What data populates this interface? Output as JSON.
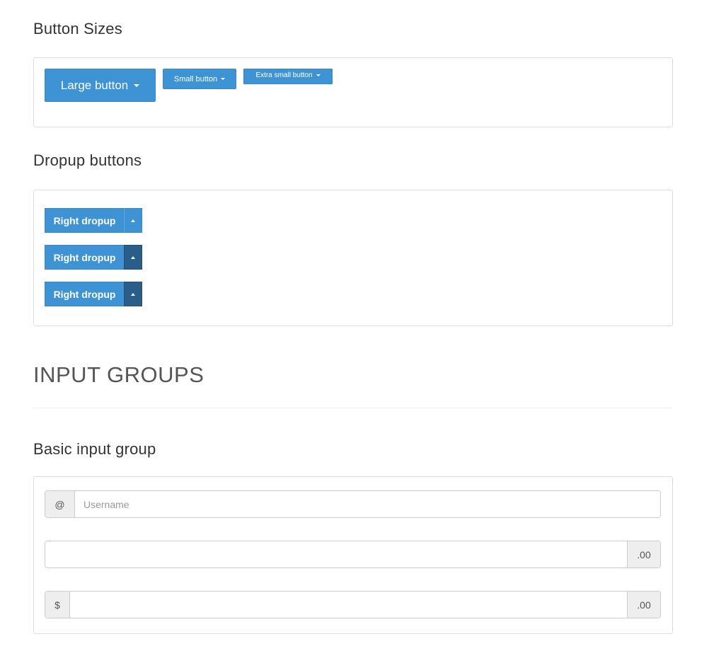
{
  "sections": {
    "button_sizes_title": "Button Sizes",
    "dropup_title": "Dropup buttons",
    "input_groups_title": "INPUT GROUPS",
    "basic_input_group_title": "Basic input group"
  },
  "button_sizes": {
    "large": "Large button",
    "small": "Small button",
    "extra_small": "Extra small button"
  },
  "dropups": [
    {
      "label": "Right dropup",
      "toggle_state": "normal"
    },
    {
      "label": "Right dropup",
      "toggle_state": "active"
    },
    {
      "label": "Right dropup",
      "toggle_state": "active"
    }
  ],
  "input_groups": {
    "username": {
      "prefix": "@",
      "placeholder": "Username",
      "value": ""
    },
    "amount": {
      "suffix": ".00",
      "value": ""
    },
    "price": {
      "prefix": "$",
      "suffix": ".00",
      "value": ""
    }
  },
  "colors": {
    "primary": "#3e93d5",
    "primary_active": "#2a5d87",
    "border": "#dddddd",
    "addon_bg": "#eeeeee"
  }
}
